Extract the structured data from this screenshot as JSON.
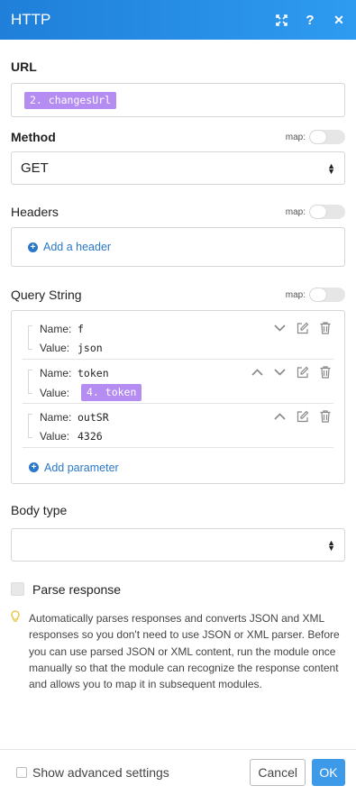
{
  "dialog": {
    "title": "HTTP",
    "icons": [
      "expand-icon",
      "help-icon",
      "close-icon"
    ]
  },
  "url": {
    "label": "URL",
    "value_pill": "2. changesUrl"
  },
  "method": {
    "label": "Method",
    "map_label": "map:",
    "value": "GET"
  },
  "headers": {
    "label": "Headers",
    "map_label": "map:",
    "add_label": "Add a header"
  },
  "query_string": {
    "label": "Query String",
    "map_label": "map:",
    "name_key": "Name:",
    "value_key": "Value:",
    "items": [
      {
        "name": "f",
        "value": "json",
        "value_is_pill": false
      },
      {
        "name": "token",
        "value": "4. token",
        "value_is_pill": true
      },
      {
        "name": "outSR",
        "value": "4326",
        "value_is_pill": false
      }
    ],
    "add_label": "Add parameter"
  },
  "body_type": {
    "label": "Body type",
    "value": ""
  },
  "parse_response": {
    "label": "Parse response",
    "checked": false,
    "info": "Automatically parses responses and converts JSON and XML responses so you don't need to use JSON or XML parser. Before you can use parsed JSON or XML content, run the module once manually so that the module can recognize the response content and allows you to map it in subsequent modules."
  },
  "footer": {
    "advanced_label": "Show advanced settings",
    "cancel_label": "Cancel",
    "ok_label": "OK"
  },
  "colors": {
    "header_gradient_start": "#1f7fd9",
    "header_gradient_end": "#2e9bf0",
    "pill": "#b48cf2",
    "link": "#2a78c7",
    "ok_button": "#3d9ae8"
  }
}
